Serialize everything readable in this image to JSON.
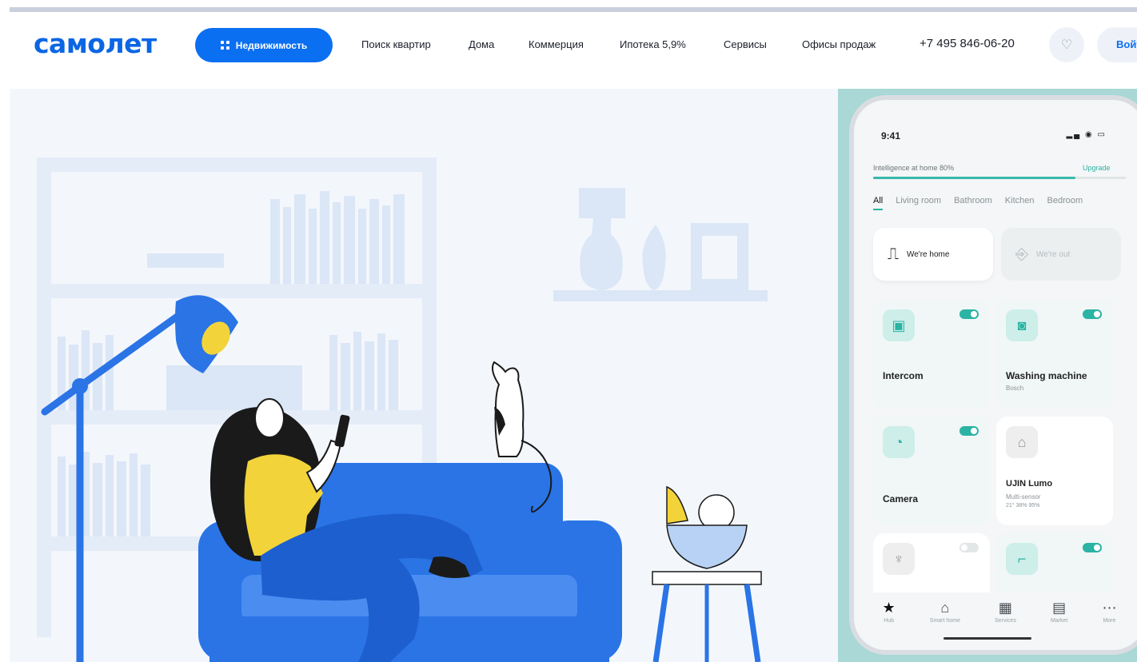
{
  "header": {
    "logo": "самолет",
    "realty_button": "Недвижимость",
    "nav": [
      "Поиск квартир",
      "Дома",
      "Коммерция",
      "Ипотека 5,9%",
      "Сервисы",
      "Офисы продаж"
    ],
    "phone": "+7 495 846-06-20",
    "login": "Войти",
    "heart_icon": "heart-icon",
    "grid_icon": "grid-icon"
  },
  "app": {
    "time": "9:41",
    "intelligence": "Intelligence at home 80%",
    "intelligence_progress": 0.8,
    "upgrade": "Upgrade",
    "rooms": [
      "All",
      "Living room",
      "Bathroom",
      "Kitchen",
      "Bedroom"
    ],
    "modes": [
      {
        "label": "We're home",
        "icon": "door-open-icon"
      },
      {
        "label": "We're out",
        "icon": "door-exit-icon"
      }
    ],
    "devices": [
      {
        "name": "Intercom",
        "sub": "",
        "on": true,
        "icon": "intercom-icon"
      },
      {
        "name": "Washing machine",
        "sub": "Bosch",
        "on": true,
        "icon": "washer-icon"
      },
      {
        "name": "Camera",
        "sub": "",
        "on": true,
        "icon": "camera-icon"
      },
      {
        "name": "UJIN Lumo",
        "sub": "Multi-sensor",
        "stats": "21° 38% 95%",
        "on": false,
        "icon": "sensor-icon"
      }
    ],
    "tabs": [
      {
        "label": "Hub",
        "icon": "star-icon"
      },
      {
        "label": "Smart home",
        "icon": "home-icon"
      },
      {
        "label": "Services",
        "icon": "grid-icon"
      },
      {
        "label": "Market",
        "icon": "bag-icon"
      },
      {
        "label": "More",
        "icon": "more-icon"
      }
    ]
  },
  "colors": {
    "brand": "#0b6ff2",
    "hero_bg": "#f3f7fc",
    "accent_teal": "#2bb3a3",
    "sofa": "#2a74e6"
  }
}
